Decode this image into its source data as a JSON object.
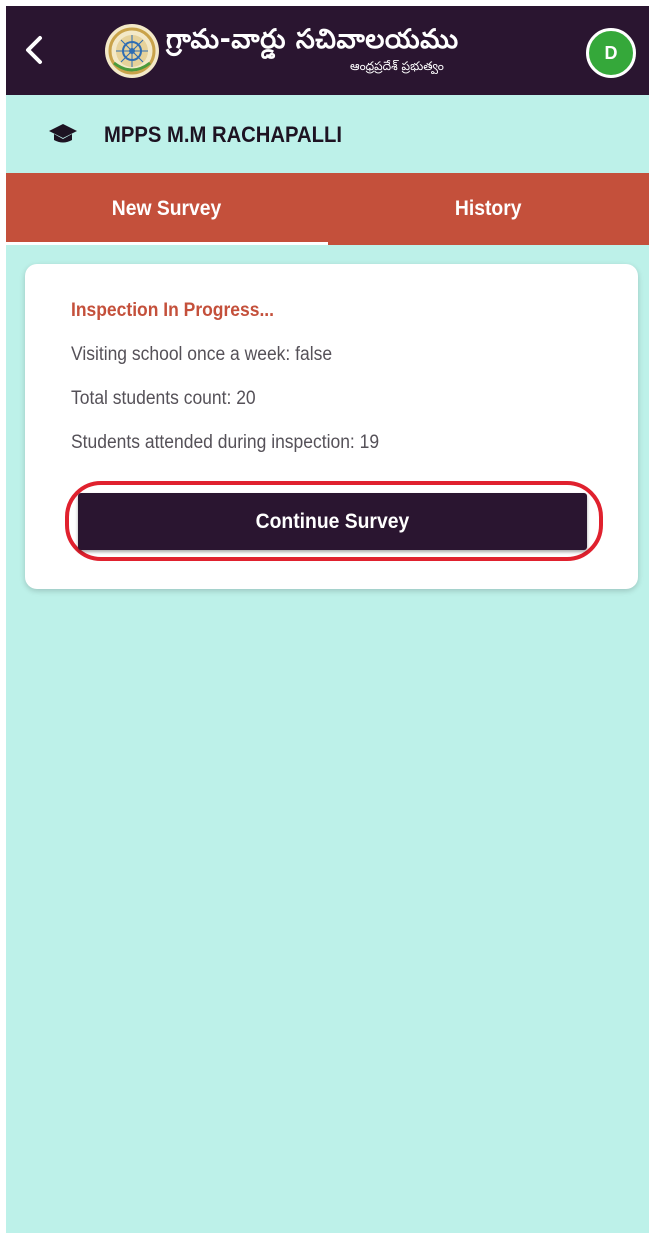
{
  "appbar": {
    "title": "గ్రామ-వార్డు సచివాలయము",
    "subtitle": "ఆంధ్రప్రదేశ్ ప్రభుత్వం",
    "avatar_initial": "D",
    "avatar_color": "#35a83a",
    "background": "#2a1530",
    "icons": [
      "back-arrow-icon",
      "state-emblem-icon"
    ]
  },
  "school": {
    "icon": "graduation-cap-icon",
    "name": "MPPS M.M RACHAPALLI"
  },
  "tabs": [
    {
      "label": "New Survey",
      "active": true
    },
    {
      "label": "History",
      "active": false
    }
  ],
  "tab_bar_color": "#c4503b",
  "card": {
    "status_title": "Inspection In Progress...",
    "lines": [
      "Visiting school once a week: false",
      "Total students count: 20",
      "Students attended during inspection: 19"
    ],
    "continue_label": "Continue Survey",
    "highlight_color": "#e0212e"
  },
  "page_background": "#bdf1e9"
}
